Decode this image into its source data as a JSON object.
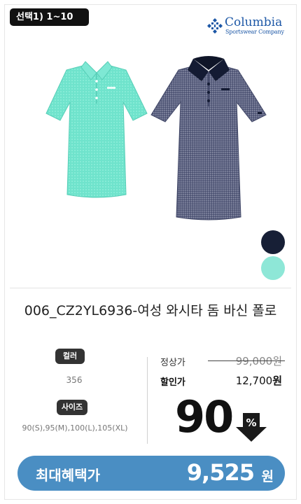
{
  "badge": {
    "select_label": "선택1) 1~10"
  },
  "brand": {
    "name": "Columbia",
    "tagline": "Sportswear Company",
    "color": "#1c57a6"
  },
  "product": {
    "title": "006_CZ2YL6936-여성 와시타 돔 바신 폴로",
    "colors": [
      {
        "name": "navy",
        "hex": "#171f36"
      },
      {
        "name": "mint",
        "hex": "#8ee7d7"
      }
    ]
  },
  "specs": {
    "color_label": "컬러",
    "color_value": "356",
    "size_label": "사이즈",
    "size_value": "90(S),95(M),100(L),105(XL)"
  },
  "price": {
    "regular_label": "정상가",
    "regular_value": "99,000",
    "regular_unit": "원",
    "sale_label": "할인가",
    "sale_value": "12,700",
    "sale_unit": "원",
    "discount_value": "90",
    "discount_symbol": "%"
  },
  "benefit": {
    "label": "최대혜택가",
    "value": "9,525",
    "unit": "원",
    "color": "#4a8ec3"
  }
}
